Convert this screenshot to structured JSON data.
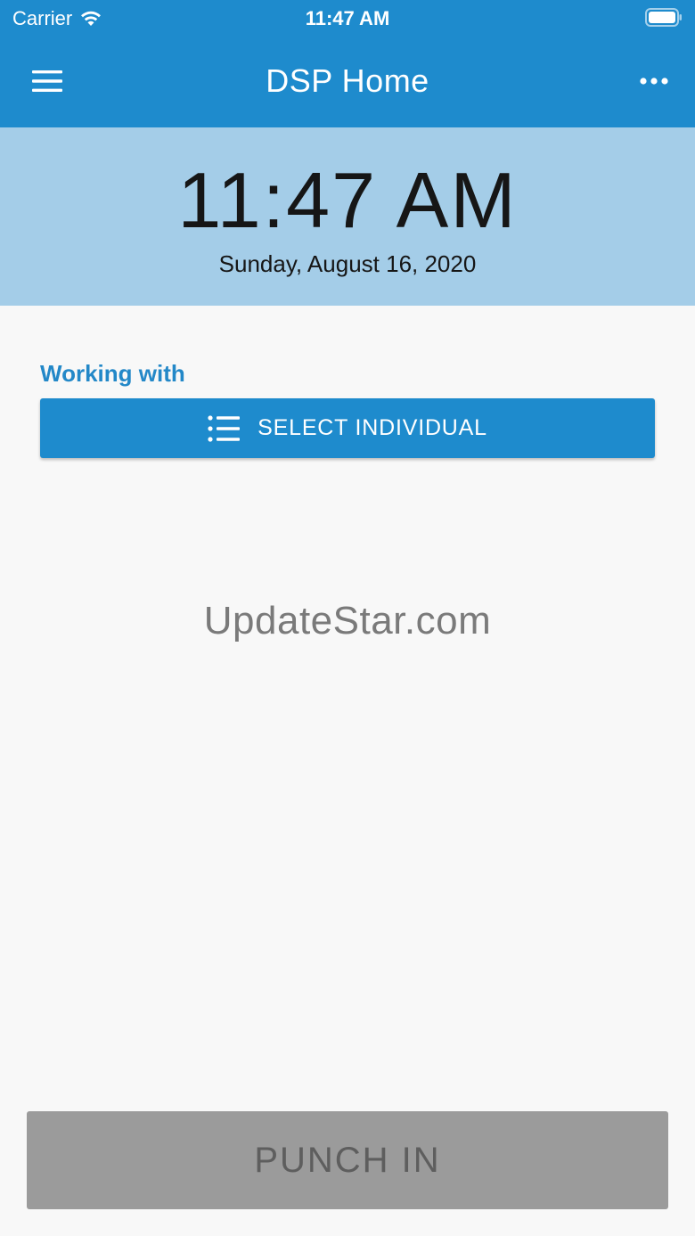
{
  "status_bar": {
    "carrier": "Carrier",
    "time": "11:47 AM",
    "wifi_icon": "wifi-icon",
    "battery_icon": "battery-icon"
  },
  "app_bar": {
    "title": "DSP Home",
    "menu_icon": "hamburger-menu-icon",
    "more_icon": "more-horizontal-icon"
  },
  "clock": {
    "time": "11:47 AM",
    "date": "Sunday, August 16, 2020"
  },
  "working_with": {
    "label": "Working with",
    "button_label": "SELECT INDIVIDUAL",
    "button_icon": "list-icon"
  },
  "watermark": "UpdateStar.com",
  "punch": {
    "label": "PUNCH IN"
  },
  "colors": {
    "primary": "#1e8bcd",
    "clock_band": "#a4cde8",
    "accent_text": "#2388c8",
    "disabled_button": "#9b9b9b"
  }
}
